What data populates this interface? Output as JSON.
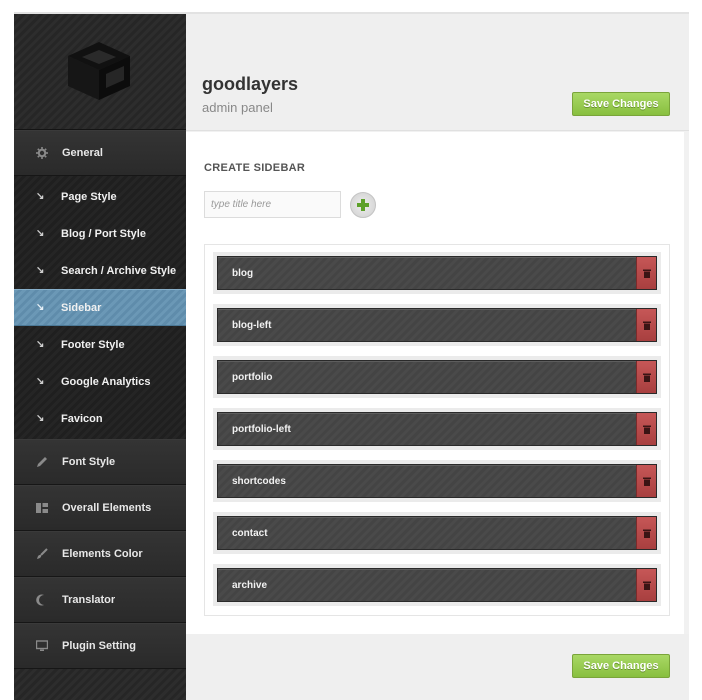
{
  "header": {
    "brand": "goodlayers",
    "subtitle": "admin panel",
    "save_label": "Save Changes"
  },
  "sidebar": {
    "logo": "goodlayers-cube-logo",
    "main_items": [
      {
        "label": "General",
        "icon": "gear-icon"
      },
      {
        "label": "Font Style",
        "icon": "pencil-icon"
      },
      {
        "label": "Overall Elements",
        "icon": "layout-icon"
      },
      {
        "label": "Elements Color",
        "icon": "brush-icon"
      },
      {
        "label": "Translator",
        "icon": "moon-icon"
      },
      {
        "label": "Plugin Setting",
        "icon": "monitor-icon"
      }
    ],
    "sub_items": [
      {
        "label": "Page Style"
      },
      {
        "label": "Blog / Port Style"
      },
      {
        "label": "Search / Archive Style"
      },
      {
        "label": "Sidebar",
        "active": true
      },
      {
        "label": "Footer Style"
      },
      {
        "label": "Google Analytics"
      },
      {
        "label": "Favicon"
      }
    ]
  },
  "content": {
    "section_title": "CREATE SIDEBAR",
    "input_placeholder": "type title here",
    "sidebars": [
      "blog",
      "blog-left",
      "portfolio",
      "portfolio-left",
      "shortcodes",
      "contact",
      "archive"
    ]
  },
  "footer": {
    "save_label": "Save Changes"
  },
  "colors": {
    "accent_green": "#8cc443",
    "active_blue": "#6691b0",
    "delete_red": "#b84a4a"
  }
}
